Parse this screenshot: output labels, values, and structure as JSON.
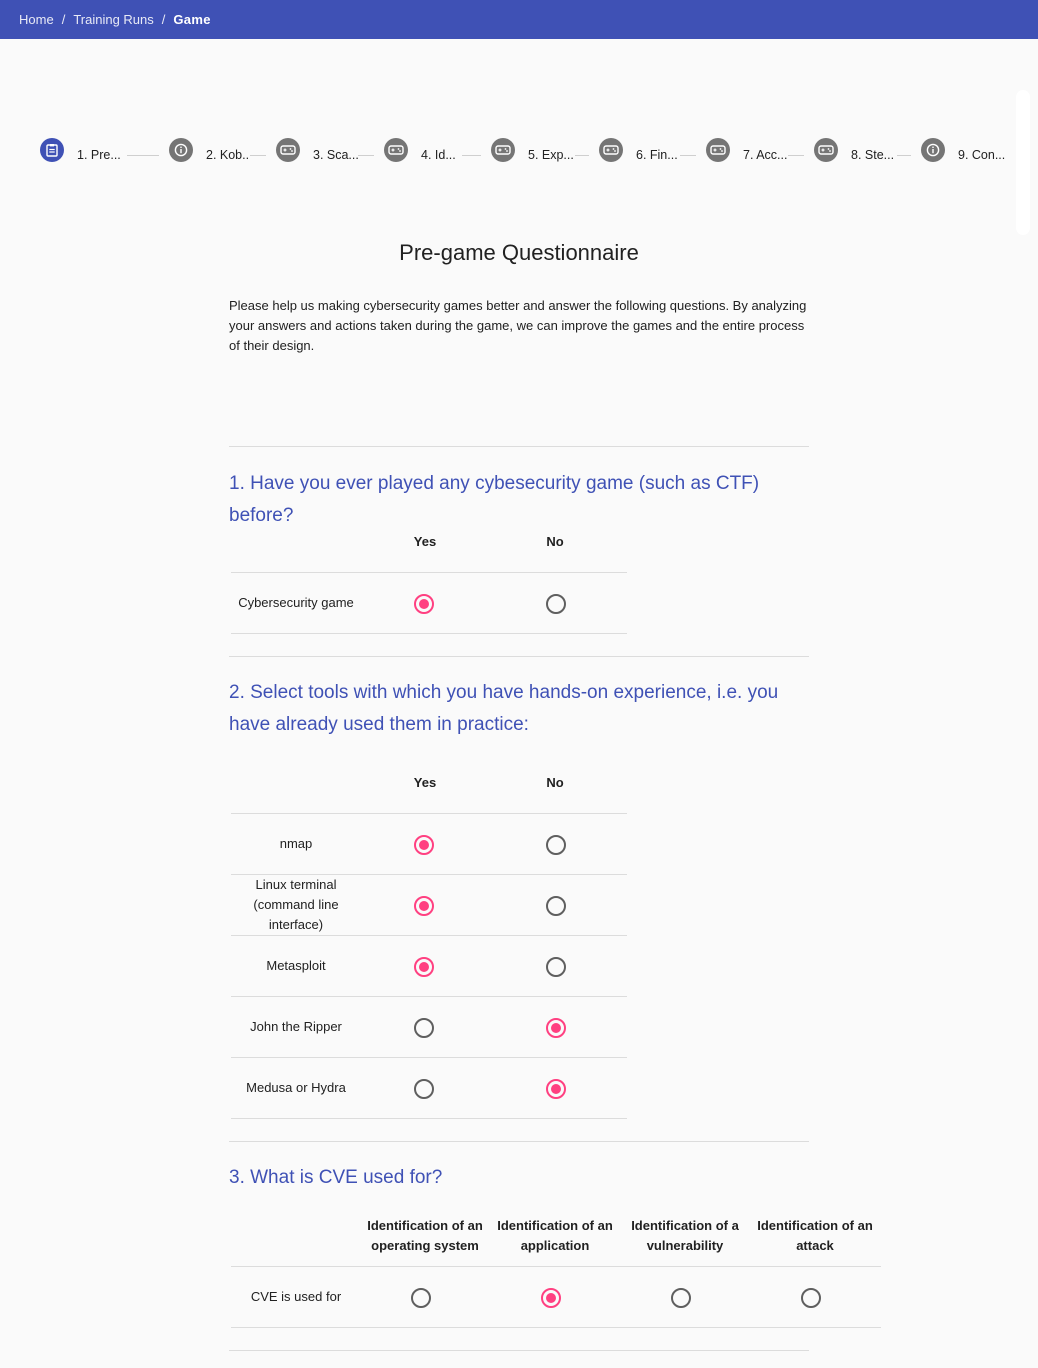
{
  "breadcrumb": {
    "items": [
      "Home",
      "Training Runs"
    ],
    "current": "Game",
    "separator": "/"
  },
  "stepper": {
    "steps": [
      {
        "label": "1. Pre...",
        "icon": "assignment-icon",
        "active": true
      },
      {
        "label": "2. Kob..",
        "icon": "info-icon"
      },
      {
        "label": "3. Sca...",
        "icon": "gamepad-icon"
      },
      {
        "label": "4. Id...",
        "icon": "gamepad-icon"
      },
      {
        "label": "5. Exp...",
        "icon": "gamepad-icon"
      },
      {
        "label": "6. Fin...",
        "icon": "gamepad-icon"
      },
      {
        "label": "7. Acc...",
        "icon": "gamepad-icon"
      },
      {
        "label": "8. Ste...",
        "icon": "gamepad-icon"
      },
      {
        "label": "9. Con...",
        "icon": "info-icon"
      }
    ]
  },
  "page": {
    "title": "Pre-game Questionnaire",
    "intro": "Please help us making cybersecurity games better and answer the following questions. By analyzing your answers and actions taken during the game, we can improve the games and the entire process of their design."
  },
  "questions": [
    {
      "text": "1. Have you ever played any cybesecurity game (such as CTF) before?",
      "columns": [
        "Yes",
        "No"
      ],
      "rows": [
        {
          "label": "Cybersecurity game",
          "selected": 0
        }
      ]
    },
    {
      "text": "2. Select tools with which you have hands-on experience, i.e. you have already used them in practice:",
      "columns": [
        "Yes",
        "No"
      ],
      "rows": [
        {
          "label": "nmap",
          "selected": 0
        },
        {
          "label": "Linux terminal (command line interface)",
          "selected": 0
        },
        {
          "label": "Metasploit",
          "selected": 0
        },
        {
          "label": "John the Ripper",
          "selected": 1
        },
        {
          "label": "Medusa or Hydra",
          "selected": 1
        }
      ]
    },
    {
      "text": "3. What is CVE used for?",
      "columns": [
        "Identification of an operating system",
        "Identification of an application",
        "Identification of a vulnerability",
        "Identification of an attack"
      ],
      "rows": [
        {
          "label": "CVE is used for",
          "selected": 1
        }
      ]
    }
  ],
  "colors": {
    "primary": "#3f51b5",
    "accent": "#ff4081"
  }
}
